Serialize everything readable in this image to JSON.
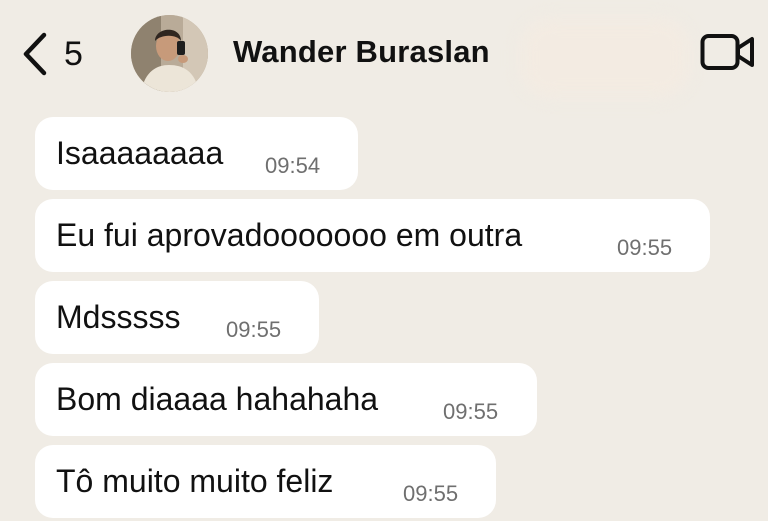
{
  "header": {
    "back_count": "5",
    "contact_name": "Wander Buraslan"
  },
  "messages": [
    {
      "text": "Isaaaaaaaa",
      "time": "09:54"
    },
    {
      "text": "Eu fui aprovadooooooo em outra",
      "time": "09:55"
    },
    {
      "text": "Mdsssss",
      "time": "09:55"
    },
    {
      "text": "Bom diaaaa hahahaha",
      "time": "09:55"
    },
    {
      "text": "Tô muito muito feliz",
      "time": "09:55"
    }
  ],
  "colors": {
    "background": "#f0ece5",
    "bubble": "#ffffff",
    "text": "#111111",
    "timestamp": "#6f6f6f"
  }
}
